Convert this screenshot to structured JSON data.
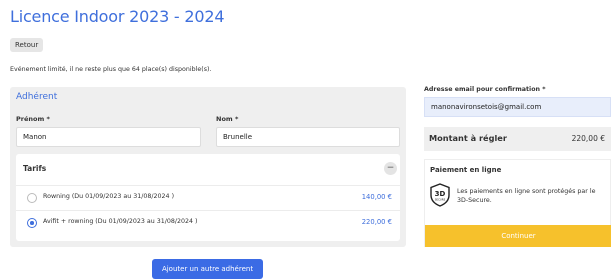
{
  "page": {
    "title": "Licence Indoor 2023 - 2024",
    "back_label": "Retour",
    "notice": "Evénement limité, il ne reste plus que 64 place(s) disponible(s)."
  },
  "member": {
    "section_title": "Adhérent",
    "first_name_label": "Prénom *",
    "first_name_value": "Manon",
    "last_name_label": "Nom *",
    "last_name_value": "Brunelle"
  },
  "tarifs": {
    "title": "Tarifs",
    "collapse_symbol": "−",
    "options": [
      {
        "label": "Rowning (Du 01/09/2023 au 31/08/2024 )",
        "price": "140,00 €",
        "selected": false
      },
      {
        "label": "Avifit + rowning (Du 01/09/2023 au 31/08/2024 )",
        "price": "220,00 €",
        "selected": true
      }
    ]
  },
  "add_member_label": "Ajouter un autre adhérent",
  "confirmation": {
    "email_label": "Adresse email pour confirmation *",
    "email_value": "manonavironsetois@gmail.com"
  },
  "total": {
    "label": "Montant à régler",
    "value": "220,00 €"
  },
  "payment": {
    "title": "Paiement en ligne",
    "secure_text": "Les paiements en ligne sont protégés par le 3D-Secure.",
    "icon": "3d-secure-shield-icon",
    "icon_text": "3D",
    "icon_subtext": "SECURE",
    "continue_label": "Continuer"
  },
  "colors": {
    "accent": "#3f6fdc",
    "button_blue": "#3b6be5",
    "continue_yellow": "#f6c12c",
    "panel_gray": "#efefef"
  }
}
